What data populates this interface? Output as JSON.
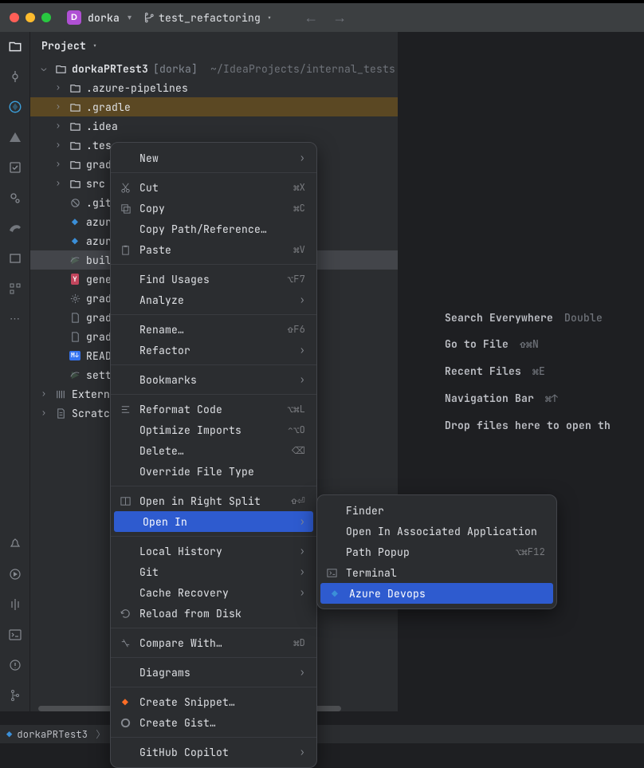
{
  "titlebar": {
    "project_initial": "D",
    "project_name": "dorka",
    "branch_name": "test_refactoring"
  },
  "panel": {
    "title": "Project"
  },
  "tree": {
    "root": "dorkaPRTest3",
    "root_suffix": "[dorka]",
    "root_path": "~/IdeaProjects/internal_tests",
    "items": [
      {
        "label": ".azure-pipelines",
        "icon": "folder",
        "indent": 2,
        "expander": ">"
      },
      {
        "label": ".gradle",
        "icon": "folder",
        "indent": 2,
        "expander": ">",
        "selected": true
      },
      {
        "label": ".idea",
        "icon": "folder",
        "indent": 2,
        "expander": ">"
      },
      {
        "label": ".tes",
        "icon": "folder",
        "indent": 2,
        "expander": ">"
      },
      {
        "label": "grad",
        "icon": "folder",
        "indent": 2,
        "expander": ">"
      },
      {
        "label": "src",
        "icon": "folder",
        "indent": 2,
        "expander": ">"
      },
      {
        "label": ".git",
        "icon": "blocked",
        "indent": 2,
        "expander": ""
      },
      {
        "label": "azur",
        "icon": "azure",
        "indent": 2,
        "expander": ""
      },
      {
        "label": "azur",
        "icon": "azure",
        "indent": 2,
        "expander": ""
      },
      {
        "label": "buil",
        "icon": "gradle-run",
        "indent": 2,
        "expander": "",
        "selected2": true
      },
      {
        "label": "gene",
        "icon": "yaml",
        "indent": 2,
        "expander": ""
      },
      {
        "label": "grad",
        "icon": "gear",
        "indent": 2,
        "expander": ""
      },
      {
        "label": "grad",
        "icon": "file",
        "indent": 2,
        "expander": ""
      },
      {
        "label": "grad",
        "icon": "file",
        "indent": 2,
        "expander": ""
      },
      {
        "label": "READ",
        "icon": "md",
        "indent": 2,
        "expander": ""
      },
      {
        "label": "sett",
        "icon": "gradle-run",
        "indent": 2,
        "expander": ""
      }
    ],
    "external": "Extern",
    "scratches": "Scratch"
  },
  "welcome": {
    "lines": [
      {
        "label": "Search Everywhere",
        "kb": "Double"
      },
      {
        "label": "Go to File",
        "kb": "⇧⌘N"
      },
      {
        "label": "Recent Files",
        "kb": "⌘E"
      },
      {
        "label": "Navigation Bar",
        "kb": "⌘↑"
      },
      {
        "label": "Drop files here to open th",
        "kb": ""
      }
    ]
  },
  "context_menu": [
    {
      "label": "New",
      "sub": true
    },
    {
      "sep": true
    },
    {
      "icon": "cut",
      "label": "Cut",
      "shortcut": "⌘X"
    },
    {
      "icon": "copy",
      "label": "Copy",
      "shortcut": "⌘C"
    },
    {
      "label": "Copy Path/Reference…"
    },
    {
      "icon": "paste",
      "label": "Paste",
      "shortcut": "⌘V"
    },
    {
      "sep": true
    },
    {
      "label": "Find Usages",
      "shortcut": "⌥F7"
    },
    {
      "label": "Analyze",
      "sub": true
    },
    {
      "sep": true
    },
    {
      "label": "Rename…",
      "shortcut": "⇧F6"
    },
    {
      "label": "Refactor",
      "sub": true
    },
    {
      "sep": true
    },
    {
      "label": "Bookmarks",
      "sub": true
    },
    {
      "sep": true
    },
    {
      "icon": "reformat",
      "label": "Reformat Code",
      "shortcut": "⌥⌘L"
    },
    {
      "label": "Optimize Imports",
      "shortcut": "⌃⌥O"
    },
    {
      "label": "Delete…",
      "shortcut": "⌫"
    },
    {
      "label": "Override File Type"
    },
    {
      "sep": true
    },
    {
      "icon": "split",
      "label": "Open in Right Split",
      "shortcut": "⇧⏎"
    },
    {
      "label": "Open In",
      "sub": true,
      "hi": true
    },
    {
      "sep": true
    },
    {
      "label": "Local History",
      "sub": true
    },
    {
      "label": "Git",
      "sub": true
    },
    {
      "label": "Cache Recovery",
      "sub": true
    },
    {
      "icon": "reload",
      "label": "Reload from Disk"
    },
    {
      "sep": true
    },
    {
      "icon": "diff",
      "label": "Compare With…",
      "shortcut": "⌘D"
    },
    {
      "sep": true
    },
    {
      "label": "Diagrams",
      "sub": true
    },
    {
      "sep": true
    },
    {
      "icon": "gitlab",
      "label": "Create Snippet…"
    },
    {
      "icon": "github",
      "label": "Create Gist…"
    },
    {
      "sep": true
    },
    {
      "label": "GitHub Copilot",
      "sub": true
    }
  ],
  "sub_menu": [
    {
      "label": "Finder"
    },
    {
      "label": "Open In Associated Application"
    },
    {
      "label": "Path Popup",
      "shortcut": "⌥⌘F12"
    },
    {
      "icon": "terminal",
      "label": "Terminal"
    },
    {
      "icon": "azure",
      "label": "Azure Devops",
      "hi": true
    }
  ],
  "footer": {
    "crumb": "dorkaPRTest3"
  }
}
